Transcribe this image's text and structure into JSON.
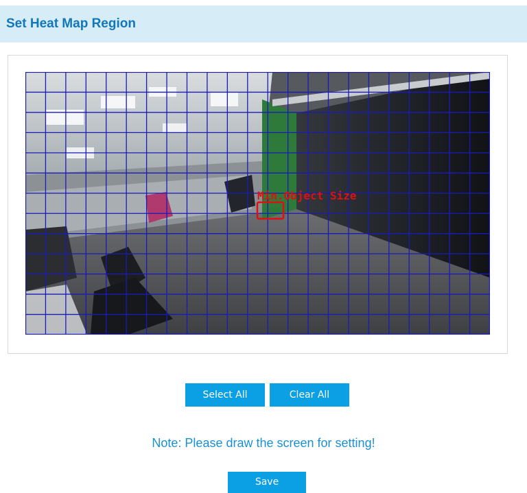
{
  "header": {
    "title": "Set Heat Map Region"
  },
  "video": {
    "overlay_label": "Min.Object Size",
    "grid": {
      "columns": 23,
      "rows": 13,
      "color": "#1a1ab8"
    },
    "overlay_color": "#e01010"
  },
  "actions": {
    "select_all_label": "Select All",
    "clear_all_label": "Clear All",
    "save_label": "Save"
  },
  "note": "Note: Please draw the screen for setting!",
  "colors": {
    "accent": "#0aa0e3",
    "header_bg": "#d6ecf7",
    "title": "#1277b8",
    "note": "#1a90d0"
  }
}
